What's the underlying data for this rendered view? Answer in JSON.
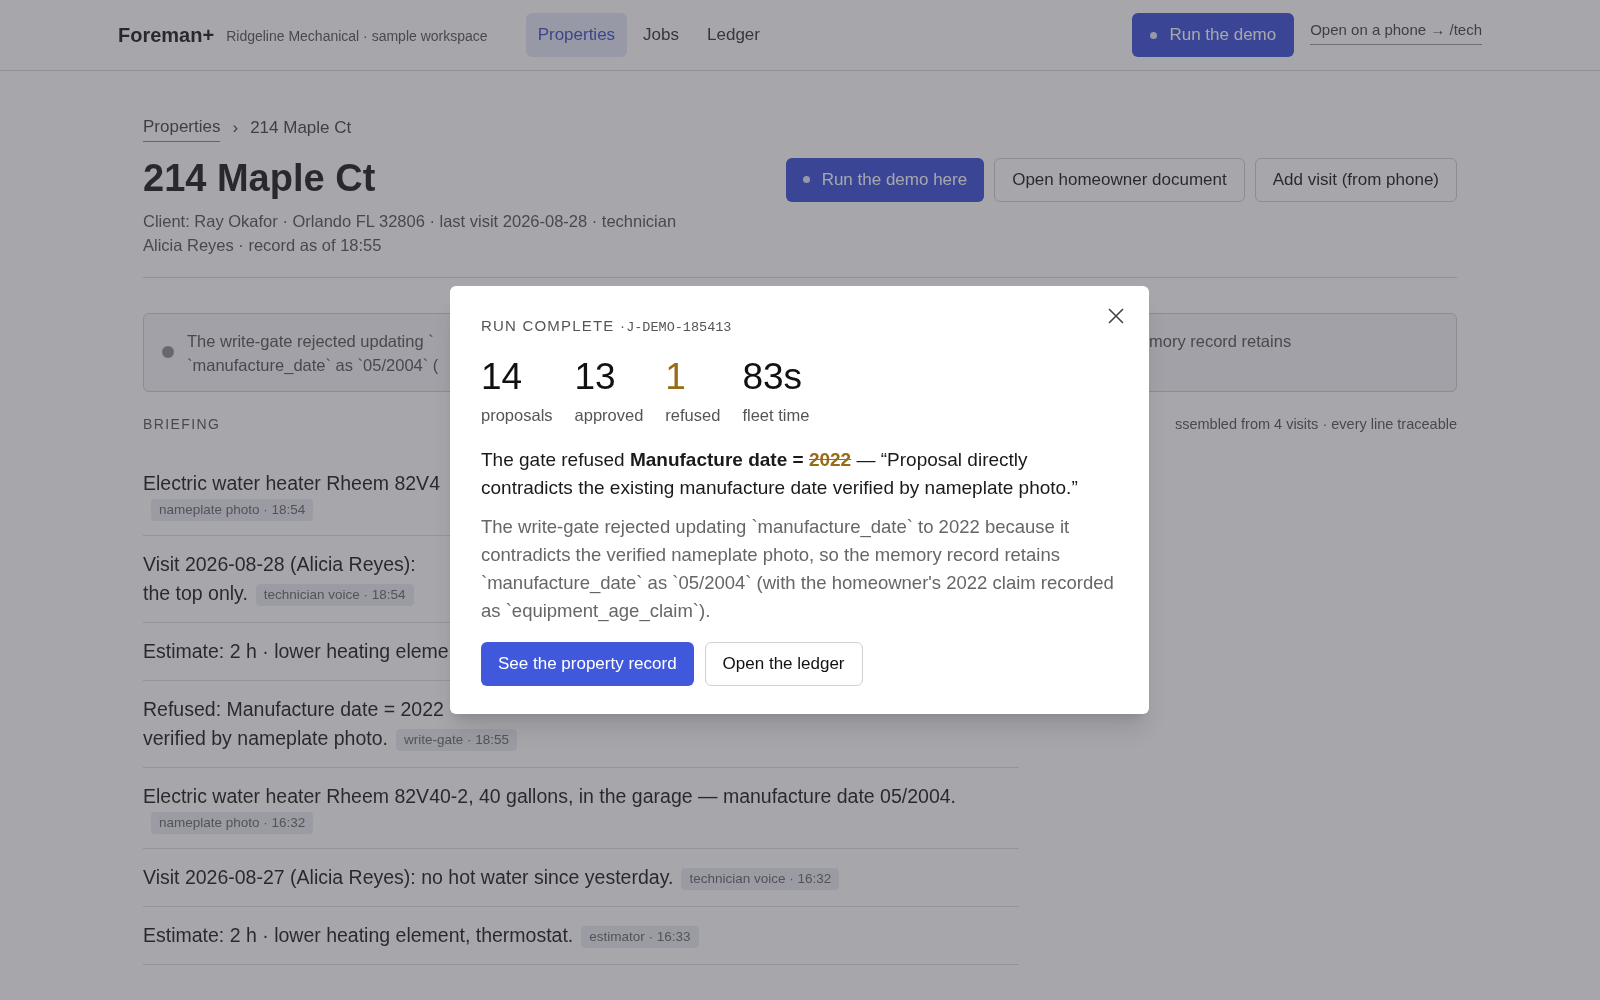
{
  "header": {
    "logo": "Foreman+",
    "workspace": "Ridgeline Mechanical · sample workspace",
    "tabs": [
      {
        "label": "Properties",
        "selected": true
      },
      {
        "label": "Jobs",
        "selected": false
      },
      {
        "label": "Ledger",
        "selected": false
      }
    ],
    "run_button": "Run the demo",
    "phone_link": "Open on a phone → /tech"
  },
  "breadcrumb": {
    "link": "Properties",
    "separator": "›",
    "current": "214 Maple Ct"
  },
  "title": "214 Maple Ct",
  "subtitle": "Client: Ray Okafor · Orlando FL 32806 · last visit 2026-08-28 · technician Alicia Reyes · record as of 18:55",
  "actions": [
    {
      "label": "Run the demo here",
      "kind": "primary"
    },
    {
      "label": "Open homeowner document",
      "kind": "outline"
    },
    {
      "label": "Add visit (from phone)",
      "kind": "outline"
    }
  ],
  "notice": {
    "left_lines": [
      "The write-gate rejected updating `",
      "`manufacture_date` as `05/2004` ("
    ],
    "right_text": "mory record retains"
  },
  "briefing": {
    "heading": "BRIEFING",
    "meta": "ssembled from 4 visits · every line traceable",
    "rows": [
      {
        "lines": [
          "Electric water heater Rheem 82V4"
        ],
        "tag": "nameplate photo · 18:54",
        "tag_on_new_line": true
      },
      {
        "lines": [
          "Visit 2026-08-28 (Alicia Reyes):",
          "the top only."
        ],
        "tag": "technician voice · 18:54",
        "tag_on_new_line": false
      },
      {
        "lines": [
          "Estimate: 2 h · lower heating eleme"
        ]
      },
      {
        "lines": [
          "Refused: Manufacture date = 2022",
          "verified by nameplate photo."
        ],
        "tag": "write-gate · 18:55",
        "tag_on_new_line": false
      },
      {
        "lines": [
          "Electric water heater Rheem 82V40-2, 40 gallons, in the garage — manufacture date 05/2004."
        ],
        "tag": "nameplate photo · 16:32",
        "tag_on_new_line": true
      },
      {
        "lines": [
          "Visit 2026-08-27 (Alicia Reyes): no hot water since yesterday."
        ],
        "tag": "technician voice · 16:32",
        "tag_on_new_line": false
      },
      {
        "lines": [
          "Estimate: 2 h · lower heating element, thermostat."
        ],
        "tag": "estimator · 16:33",
        "tag_on_new_line": false
      }
    ]
  },
  "modal": {
    "label": "RUN COMPLETE · ",
    "job_id": "J-DEMO-185413",
    "stats": [
      {
        "value": "14",
        "label": "proposals",
        "kind": "normal"
      },
      {
        "value": "13",
        "label": "approved",
        "kind": "normal"
      },
      {
        "value": "1",
        "label": "refused",
        "kind": "refused"
      },
      {
        "value": "83s",
        "label": "fleet time",
        "kind": "normal"
      }
    ],
    "refusal": {
      "lead": "The gate refused ",
      "field": "Manufacture date =",
      "value": "2022",
      "quote": " — “Proposal directly contradicts the existing manufacture date verified by nameplate photo.”"
    },
    "explanation": "The write-gate rejected updating `manufacture_date` to 2022 because it contradicts the verified nameplate photo, so the memory record retains `manufacture_date` as `05/2004` (with the homeowner's 2022 claim recorded as `equipment_age_claim`).",
    "buttons": [
      {
        "label": "See the property record",
        "kind": "primary"
      },
      {
        "label": "Open the ledger",
        "kind": "outline"
      }
    ]
  }
}
